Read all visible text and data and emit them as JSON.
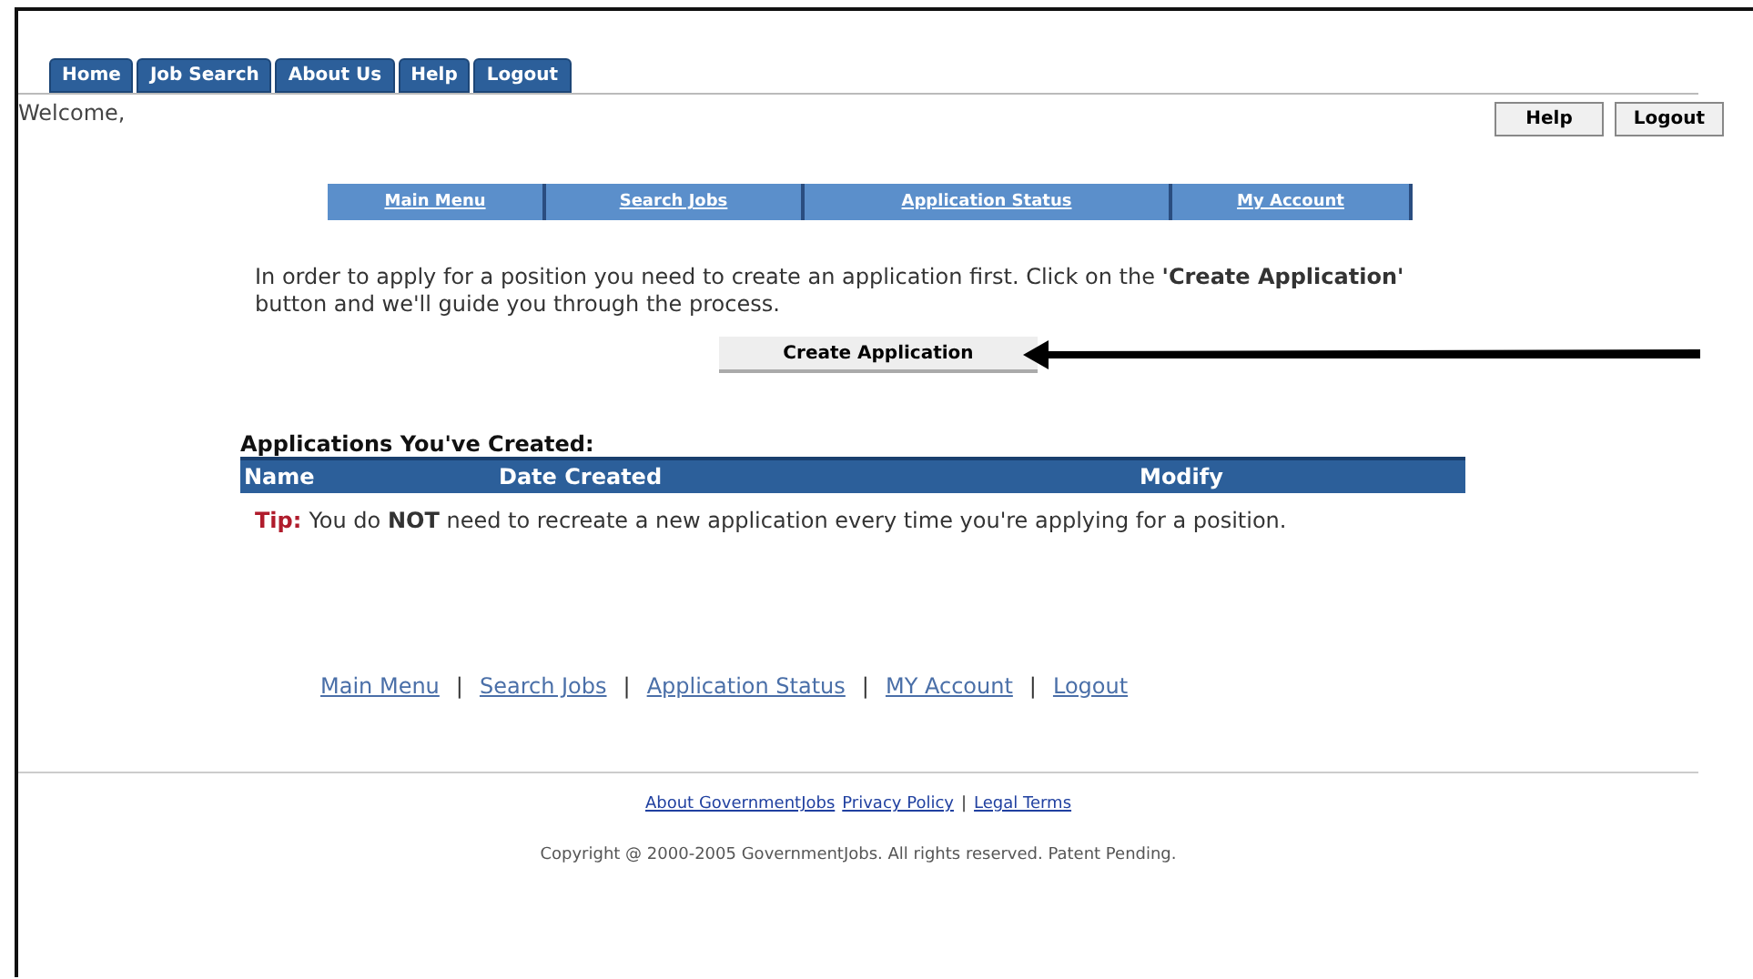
{
  "tabs": [
    {
      "label": "Home",
      "selected": false
    },
    {
      "label": "Job Search",
      "selected": false
    },
    {
      "label": "About Us",
      "selected": false
    },
    {
      "label": "Help",
      "selected": false
    },
    {
      "label": "Logout",
      "selected": false
    }
  ],
  "welcome": "Welcome,",
  "top_buttons": [
    "Help",
    "Logout"
  ],
  "subnav": [
    {
      "label": "Main Menu"
    },
    {
      "label": "Search Jobs"
    },
    {
      "label": "Application Status"
    },
    {
      "label": "My Account"
    }
  ],
  "intro": "In order to apply for a position you need to create an application first. Click on the **'Create Application'** button and we'll guide you through the process.",
  "create_button": "Create Application",
  "applications": {
    "heading": "Applications You've Created:",
    "columns": [
      "Name",
      "Date Created",
      "Modify"
    ]
  },
  "tip": {
    "label": "Tip:",
    "text": "You do **NOT** need to recreate a new application every time you're applying for a position."
  },
  "bottom_links": [
    "Main Menu",
    "Search Jobs",
    "Application Status",
    "MY Account",
    "Logout"
  ],
  "separator": "|",
  "footer_links": [
    "About GovernmentJobs",
    "Privacy Policy",
    "Legal Terms"
  ],
  "copyright": "Copyright @ 2000-2005 GovernmentJobs. All rights reserved. Patent Pending."
}
